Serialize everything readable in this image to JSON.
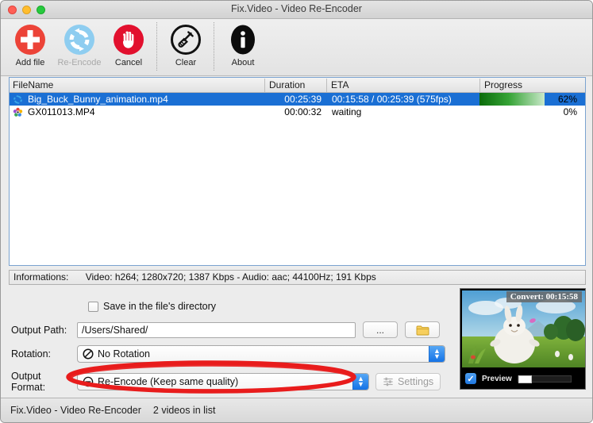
{
  "window": {
    "title": "Fix.Video - Video Re-Encoder",
    "traffic_lights": [
      "close",
      "minimize",
      "zoom"
    ]
  },
  "toolbar": {
    "buttons": [
      {
        "label": "Add file",
        "icon": "plus-circle-icon",
        "enabled": true
      },
      {
        "label": "Re-Encode",
        "icon": "refresh-circle-icon",
        "enabled": false
      },
      {
        "label": "Cancel",
        "icon": "stop-hand-icon",
        "enabled": true
      },
      {
        "label": "Clear",
        "icon": "broom-circle-icon",
        "enabled": true
      },
      {
        "label": "About",
        "icon": "info-circle-icon",
        "enabled": true
      }
    ]
  },
  "file_list": {
    "columns": [
      "FileName",
      "Duration",
      "ETA",
      "Progress"
    ],
    "rows": [
      {
        "icon": "refresh-blue-icon",
        "name": "Big_Buck_Bunny_animation.mp4",
        "duration": "00:25:39",
        "eta": "00:15:58 / 00:25:39 (575fps)",
        "progress_label": "62%",
        "progress_value": 62,
        "selected": true
      },
      {
        "icon": "gopro-flower-icon",
        "name": "GX011013.MP4",
        "duration": "00:00:32",
        "eta": "waiting",
        "progress_label": "0%",
        "progress_value": 0,
        "selected": false
      }
    ]
  },
  "informations": {
    "label": "Informations:",
    "value": "Video: h264; 1280x720; 1387 Kbps - Audio: aac; 44100Hz; 191 Kbps"
  },
  "options": {
    "save_in_file_directory": {
      "label": "Save in the file's directory",
      "checked": false
    },
    "output_path": {
      "label": "Output Path:",
      "value": "/Users/Shared/",
      "browse_label": "...",
      "folder_icon": "folder-icon"
    },
    "rotation": {
      "label": "Rotation:",
      "value": "No Rotation",
      "icon": "no-rotation-icon"
    },
    "output_format": {
      "label": "Output Format:",
      "value": "Re-Encode (Keep same quality)",
      "icon": "minus-circle-icon",
      "settings_label": "Settings",
      "settings_icon": "sliders-icon",
      "settings_enabled": false
    }
  },
  "preview": {
    "badge": "Convert: 00:15:58",
    "checkbox_label": "Preview",
    "checked": true,
    "slider_position": 0
  },
  "status_bar": {
    "app_name": "Fix.Video - Video Re-Encoder",
    "count_text": "2 videos in list"
  },
  "annotation": {
    "shape": "red-ellipse",
    "color": "#e81c1c",
    "targets": "output_format"
  },
  "colors": {
    "selection_blue": "#1a6fd4",
    "progress_green": "#35a335",
    "accent_blue": "#1573e6",
    "annotation_red": "#e81c1c"
  }
}
